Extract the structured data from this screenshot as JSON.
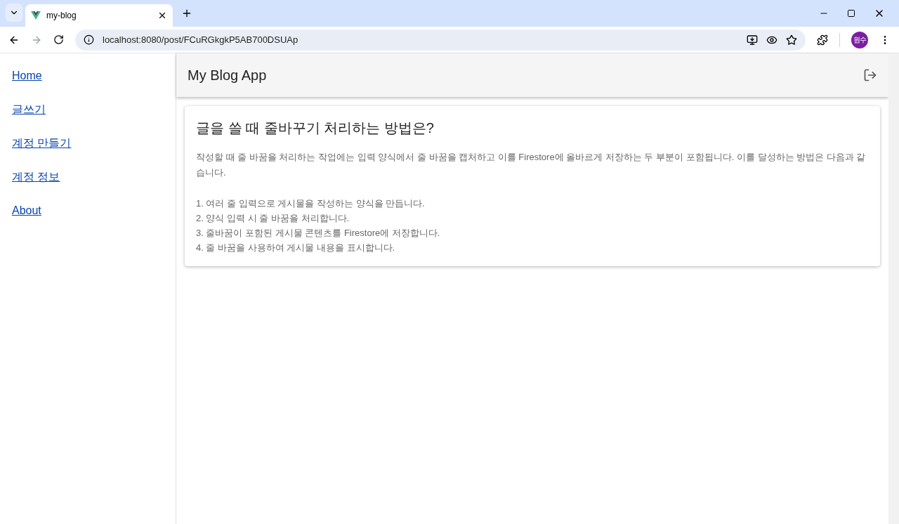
{
  "browser": {
    "tab_title": "my-blog",
    "url": "localhost:8080/post/FCuRGkgkP5AB700DSUAp",
    "profile": "원수"
  },
  "sidebar": {
    "items": [
      {
        "label": "Home"
      },
      {
        "label": "글쓰기"
      },
      {
        "label": "계정 만들기"
      },
      {
        "label": "계정 정보"
      },
      {
        "label": "About"
      }
    ]
  },
  "app_bar": {
    "title": "My Blog App"
  },
  "post": {
    "title": "글을 쓸 때 줄바꾸기 처리하는 방법은?",
    "intro": "작성할 때 줄 바꿈을 처리하는 작업에는 입력 양식에서 줄 바꿈을 캡처하고 이를 Firestore에 올바르게 저장하는 두 부분이 포함됩니다. 이를 달성하는 방법은 다음과 같습니다.",
    "steps": [
      "1. 여러 줄 입력으로 게시물을 작성하는 양식을 만듭니다.",
      "2. 양식 입력 시 줄 바꿈을 처리합니다.",
      "3. 줄바꿈이 포함된 게시물 콘텐츠를 Firestore에 저장합니다.",
      "4. 줄 바꿈을 사용하여 게시물 내용을 표시합니다."
    ]
  }
}
